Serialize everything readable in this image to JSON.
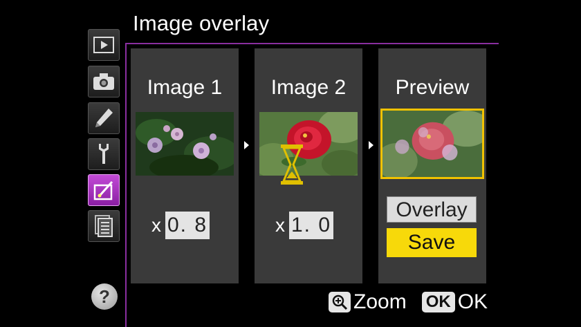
{
  "title": "Image overlay",
  "sidebar": {
    "items": [
      {
        "name": "playback",
        "icon": "playback-icon"
      },
      {
        "name": "shooting",
        "icon": "camera-icon"
      },
      {
        "name": "custom-settings",
        "icon": "pencil-icon"
      },
      {
        "name": "setup",
        "icon": "wrench-icon"
      },
      {
        "name": "retouch",
        "icon": "retouch-icon",
        "active": true
      },
      {
        "name": "my-menu",
        "icon": "menu-list-icon"
      }
    ],
    "help_label": "?"
  },
  "panels": {
    "image1": {
      "title": "Image 1",
      "gain_prefix": "x",
      "gain": "0. 8"
    },
    "image2": {
      "title": "Image 2",
      "gain_prefix": "x",
      "gain": "1. 0"
    },
    "preview": {
      "title": "Preview",
      "overlay_label": "Overlay",
      "save_label": "Save"
    }
  },
  "footer": {
    "zoom_label": "Zoom",
    "ok_key": "OK",
    "ok_label": "OK"
  },
  "colors": {
    "accent_purple": "#8a2ea0",
    "selection_yellow": "#f2c200",
    "save_yellow": "#f7d90a",
    "panel_gray": "#3a3a3a"
  }
}
